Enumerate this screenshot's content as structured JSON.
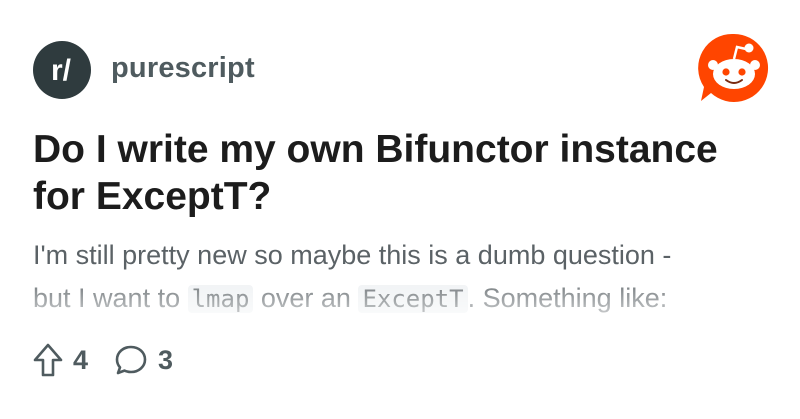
{
  "subreddit": {
    "icon": "subreddit-r-slash-icon",
    "icon_text": "r/",
    "name": "purescript"
  },
  "brand": {
    "logo": "reddit-snoo-logo",
    "color": "#ff4500"
  },
  "post": {
    "title": "Do I write my own Bifunctor instance for ExceptT?",
    "preview": {
      "line1": "I'm still pretty new so maybe this is a dumb question -",
      "line2_before": "but I want to ",
      "line2_code1": "lmap",
      "line2_middle": " over an ",
      "line2_code2": "ExceptT",
      "line2_after": ". Something like:"
    }
  },
  "stats": {
    "upvotes": "4",
    "upvote_icon": "upvote-arrow-icon",
    "comments": "3",
    "comment_icon": "comment-bubble-icon"
  }
}
